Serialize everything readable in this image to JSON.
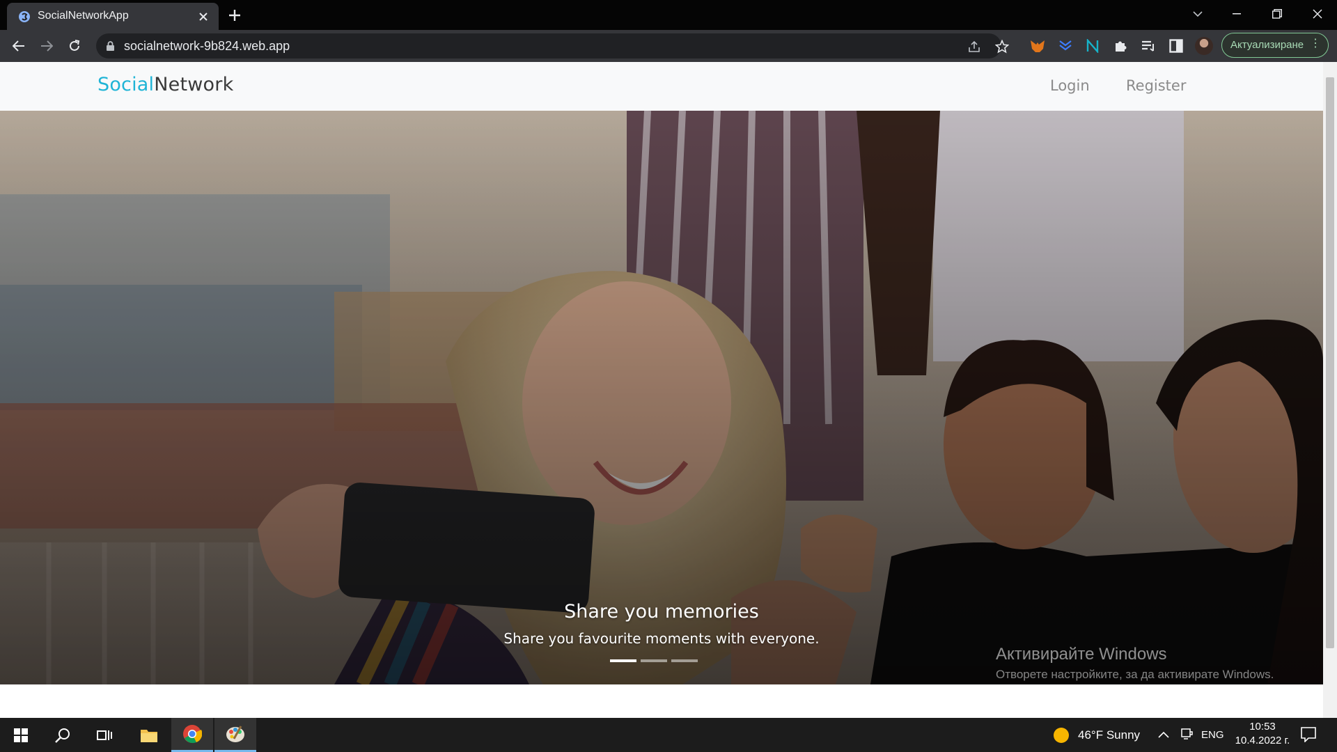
{
  "browser": {
    "tab_title": "SocialNetworkApp",
    "url": "socialnetwork-9b824.web.app",
    "update_label": "Актуализиране"
  },
  "navbar": {
    "brand_part1": "Social",
    "brand_part2": "Network",
    "login_label": "Login",
    "register_label": "Register"
  },
  "carousel": {
    "caption_title": "Share you memories",
    "caption_text": "Share you favourite moments with everyone.",
    "active_slide": 1,
    "slide_count": 3
  },
  "watermark": {
    "title": "Активирайте Windows",
    "text": "Отворете настройките, за да активирате Windows."
  },
  "taskbar": {
    "weather": "46°F  Sunny",
    "language": "ENG",
    "time": "10:53",
    "date": "10.4.2022 г."
  },
  "colors": {
    "brand_accent": "#1fb4d6",
    "update_green": "#81c995",
    "taskbar_active": "#76b9ed"
  },
  "icons": [
    "tab-favicon-icon",
    "close-icon",
    "plus-icon",
    "chevron-down-icon",
    "minimize-icon",
    "restore-icon",
    "window-close-icon",
    "back-icon",
    "forward-icon",
    "reload-icon",
    "lock-icon",
    "share-icon",
    "star-icon",
    "metamask-icon",
    "extension-icon",
    "puzzle-icon",
    "reading-list-icon",
    "side-panel-icon",
    "windows-start-icon",
    "search-icon",
    "task-view-icon",
    "file-explorer-icon",
    "chrome-icon",
    "paint-icon",
    "sun-icon",
    "notification-icon"
  ]
}
